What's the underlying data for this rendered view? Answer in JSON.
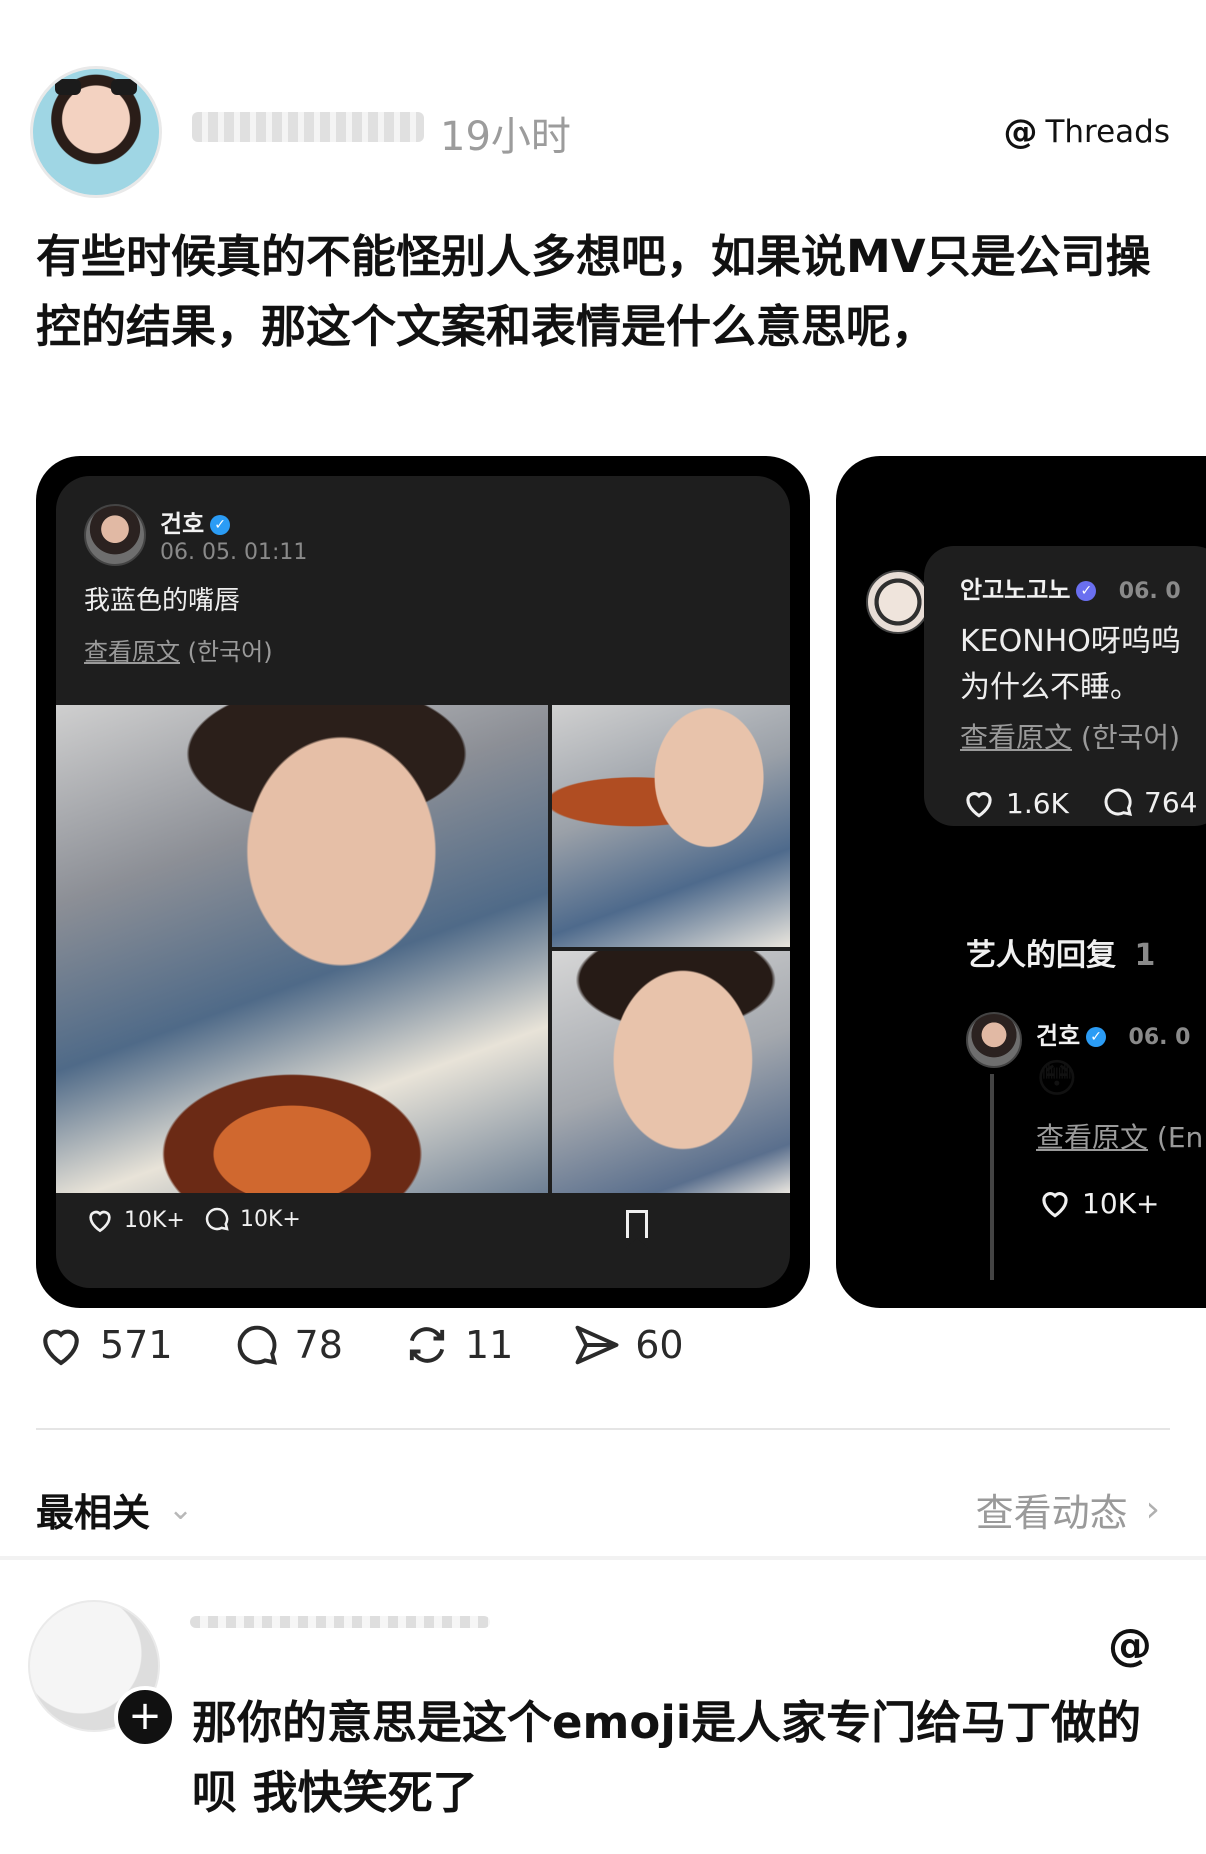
{
  "header": {
    "time": "19小时",
    "brand": "Threads"
  },
  "post": {
    "text": "有些时候真的不能怪别人多想吧，如果说MV只是公司操控的结果，那这个文案和表情是什么意思呢，"
  },
  "embedded_left": {
    "name": "건호",
    "date": "06. 05. 01:11",
    "text": "我蓝色的嘴唇",
    "view_original": "查看原文",
    "lang": "(한국어)",
    "likes": "10K+",
    "comments": "10K+"
  },
  "embedded_right": {
    "name": "안고노고노",
    "date": "06. 0",
    "text_line1": "KEONHO呀呜呜",
    "text_line2": "为什么不睡。",
    "view_original": "查看原文",
    "lang": "(한국어)",
    "likes": "1.6K",
    "comments": "764",
    "artist_reply_label": "艺人的回复",
    "artist_reply_count": "1",
    "reply_name": "건호",
    "reply_date": "06. 0",
    "reply_emoji": "😳",
    "reply_view_original": "查看原文",
    "reply_lang": "(En",
    "reply_likes": "10K+"
  },
  "stats": {
    "likes": "571",
    "comments": "78",
    "reposts": "11",
    "shares": "60"
  },
  "sort": {
    "label": "最相关",
    "activity": "查看动态"
  },
  "reply": {
    "text": "那你的意思是这个emoji是人家专门给马丁做的呗 我快笑死了"
  }
}
